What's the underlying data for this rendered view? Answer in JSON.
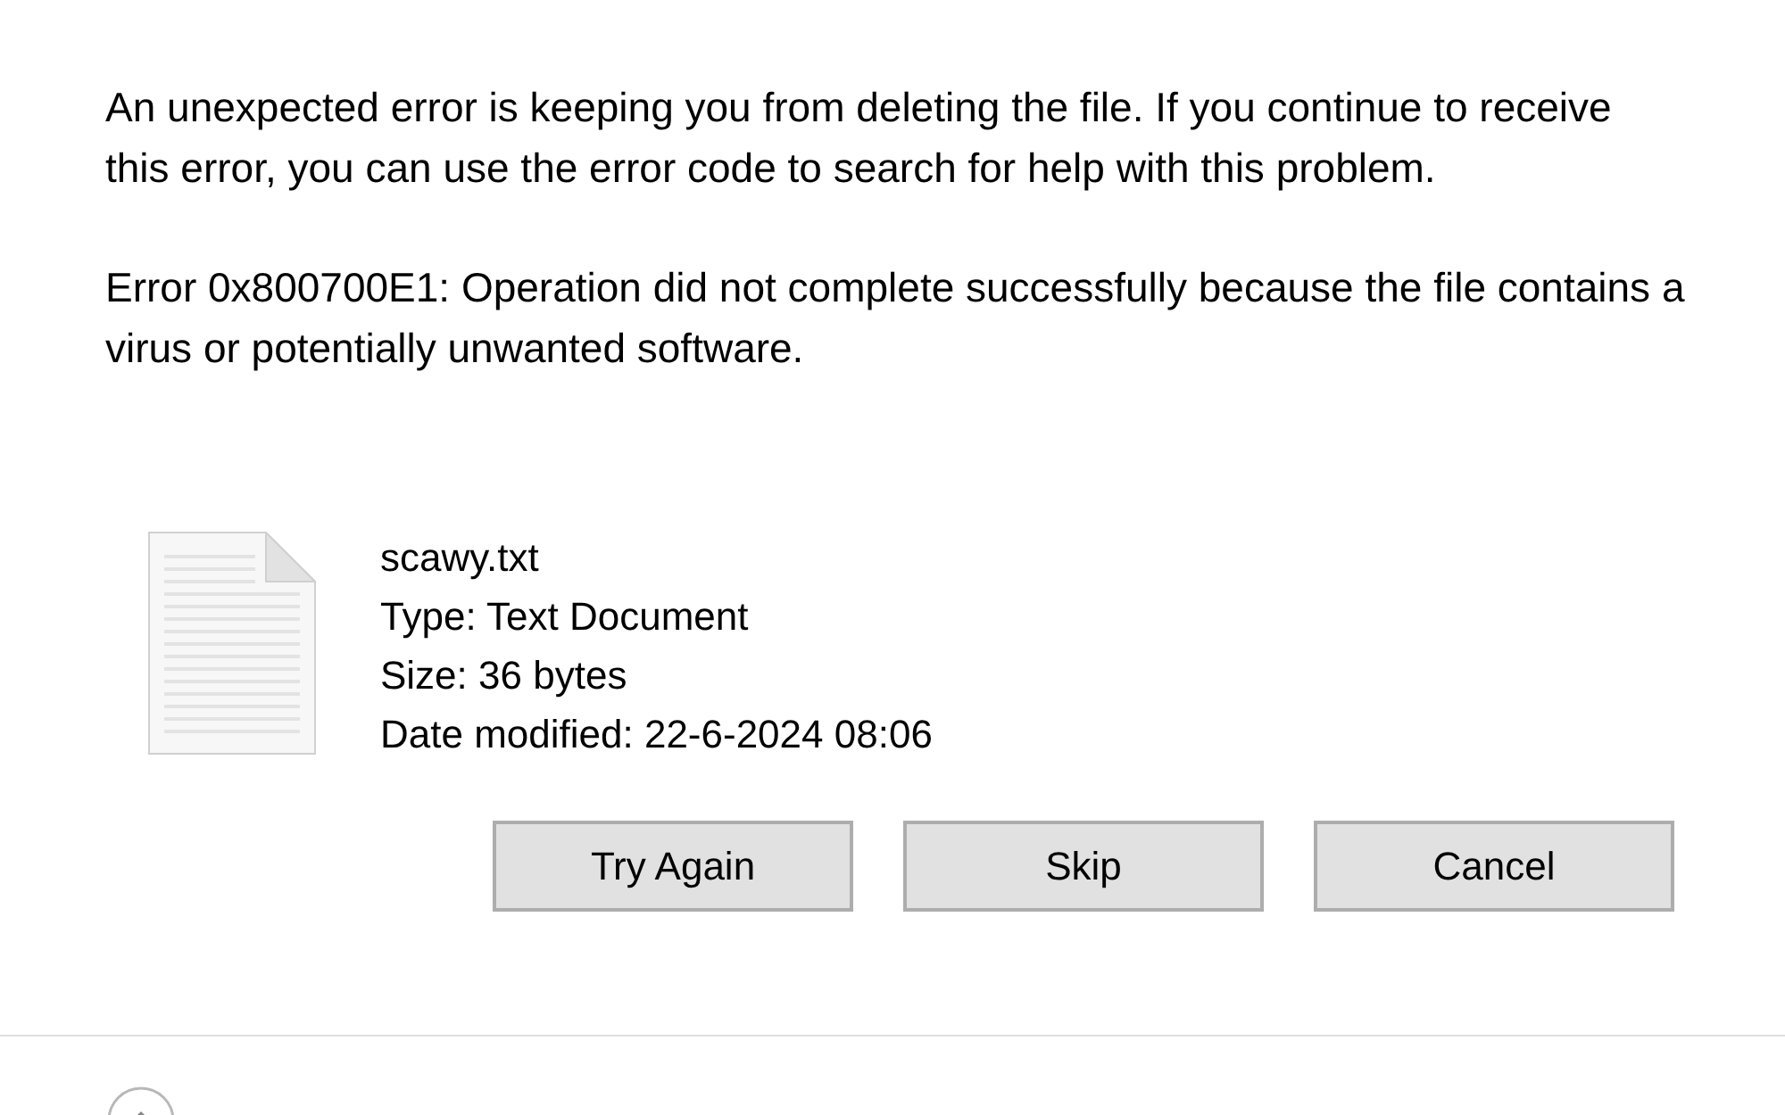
{
  "message": "An unexpected error is keeping you from deleting the file. If you continue to receive this error, you can use the error code to search for help with this problem.",
  "error": "Error 0x800700E1: Operation did not complete successfully because the file contains a virus or potentially unwanted software.",
  "file": {
    "name": "scawy.txt",
    "details": [
      "Type: Text Document",
      "Size: 36 bytes",
      "Date modified: 22-6-2024 08:06"
    ]
  },
  "buttons": [
    "Try Again",
    "Skip",
    "Cancel"
  ]
}
